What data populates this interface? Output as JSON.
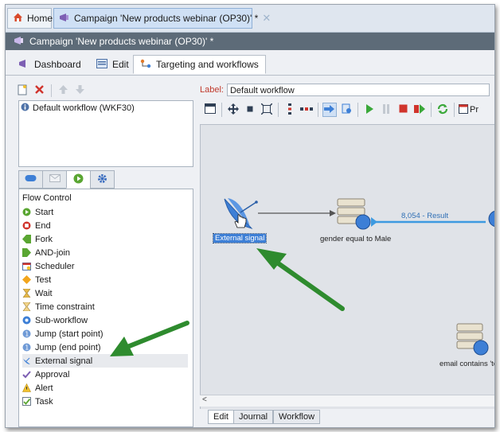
{
  "tabs": {
    "home": "Home",
    "campaign": "Campaign 'New products webinar (OP30)' *"
  },
  "window_title": "Campaign 'New products webinar (OP30)' *",
  "subtabs": {
    "dashboard": "Dashboard",
    "edit": "Edit",
    "targeting": "Targeting and workflows"
  },
  "workflow_list": {
    "item": "Default workflow (WKF30)"
  },
  "palette": {
    "header": "Flow Control",
    "items": [
      "Start",
      "End",
      "Fork",
      "AND-join",
      "Scheduler",
      "Test",
      "Wait",
      "Time constraint",
      "Sub-workflow",
      "Jump (start point)",
      "Jump (end point)",
      "External signal",
      "Approval",
      "Alert",
      "Task"
    ]
  },
  "editor": {
    "label_caption": "Label:",
    "label_value": "Default workflow",
    "toolbar_truncated": "Pr"
  },
  "canvas": {
    "node_external_signal": "External signal",
    "node_gender": "gender equal to Male",
    "transition_result": "8,054 - Result",
    "node_email": "email contains 'to"
  },
  "bottom_tabs": [
    "Edit",
    "Journal",
    "Workflow"
  ],
  "colors": {
    "accent_blue": "#3d7fd6",
    "arrow_green": "#2e8b2e",
    "title_bar": "#5d6b78"
  }
}
